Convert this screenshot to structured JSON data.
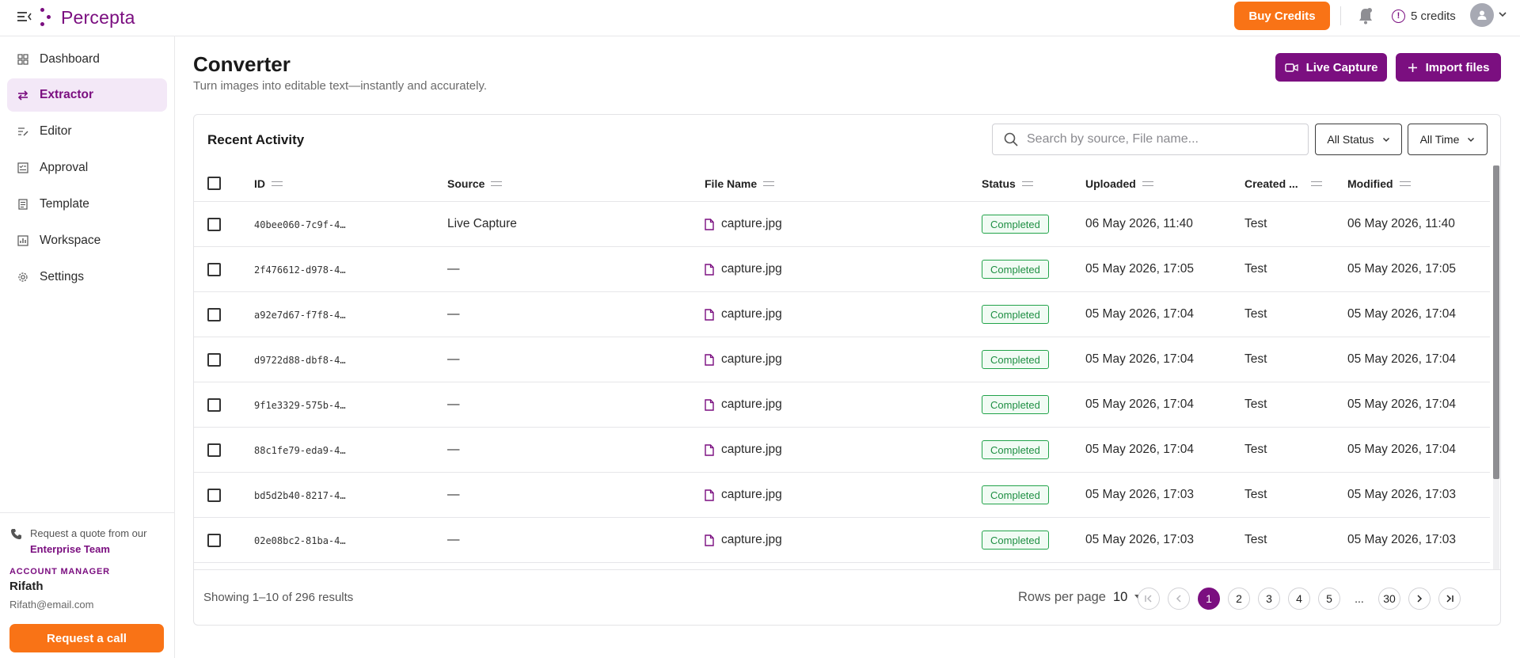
{
  "app": {
    "name": "Percepta"
  },
  "topbar": {
    "buy_label": "Buy Credits",
    "credits_label": "5 credits"
  },
  "sidebar": {
    "items": [
      {
        "label": "Dashboard",
        "icon": "grid-icon"
      },
      {
        "label": "Extractor",
        "icon": "swap-icon"
      },
      {
        "label": "Editor",
        "icon": "edit-lines-icon"
      },
      {
        "label": "Approval",
        "icon": "approval-icon"
      },
      {
        "label": "Template",
        "icon": "document-icon"
      },
      {
        "label": "Workspace",
        "icon": "chart-icon"
      },
      {
        "label": "Settings",
        "icon": "gear-icon"
      }
    ],
    "quote_text": "Request a quote from our",
    "quote_link": "Enterprise Team",
    "manager_label": "ACCOUNT MANAGER",
    "manager_name": "Rifath",
    "manager_email": "Rifath@email.com",
    "call_label": "Request a call"
  },
  "header": {
    "title": "Converter",
    "subtitle": "Turn images into editable text—instantly and accurately.",
    "live_capture_label": "Live Capture",
    "import_label": "Import files"
  },
  "activity": {
    "title": "Recent Activity",
    "search_placeholder": "Search by source, File name...",
    "status_filter": "All Status",
    "time_filter": "All Time",
    "columns": {
      "id": "ID",
      "source": "Source",
      "file_name": "File Name",
      "status": "Status",
      "uploaded": "Uploaded",
      "created_by": "Created ...",
      "modified": "Modified"
    },
    "rows": [
      {
        "id": "40bee060-7c9f-4…",
        "source": "Live Capture",
        "file": "capture.jpg",
        "status": "Completed",
        "uploaded": "06 May 2026, 11:40",
        "created_by": "Test",
        "modified": "06 May 2026, 11:40"
      },
      {
        "id": "2f476612-d978-4…",
        "source": "—",
        "file": "capture.jpg",
        "status": "Completed",
        "uploaded": "05 May 2026, 17:05",
        "created_by": "Test",
        "modified": "05 May 2026, 17:05"
      },
      {
        "id": "a92e7d67-f7f8-4…",
        "source": "—",
        "file": "capture.jpg",
        "status": "Completed",
        "uploaded": "05 May 2026, 17:04",
        "created_by": "Test",
        "modified": "05 May 2026, 17:04"
      },
      {
        "id": "d9722d88-dbf8-4…",
        "source": "—",
        "file": "capture.jpg",
        "status": "Completed",
        "uploaded": "05 May 2026, 17:04",
        "created_by": "Test",
        "modified": "05 May 2026, 17:04"
      },
      {
        "id": "9f1e3329-575b-4…",
        "source": "—",
        "file": "capture.jpg",
        "status": "Completed",
        "uploaded": "05 May 2026, 17:04",
        "created_by": "Test",
        "modified": "05 May 2026, 17:04"
      },
      {
        "id": "88c1fe79-eda9-4…",
        "source": "—",
        "file": "capture.jpg",
        "status": "Completed",
        "uploaded": "05 May 2026, 17:04",
        "created_by": "Test",
        "modified": "05 May 2026, 17:04"
      },
      {
        "id": "bd5d2b40-8217-4…",
        "source": "—",
        "file": "capture.jpg",
        "status": "Completed",
        "uploaded": "05 May 2026, 17:03",
        "created_by": "Test",
        "modified": "05 May 2026, 17:03"
      },
      {
        "id": "02e08bc2-81ba-4…",
        "source": "—",
        "file": "capture.jpg",
        "status": "Completed",
        "uploaded": "05 May 2026, 17:03",
        "created_by": "Test",
        "modified": "05 May 2026, 17:03"
      }
    ]
  },
  "pagination": {
    "showing": "Showing 1–10 of 296 results",
    "rows_per_page_label": "Rows per page",
    "rows_per_page_value": "10",
    "pages": [
      "1",
      "2",
      "3",
      "4",
      "5",
      "...",
      "30"
    ],
    "current_page": "1"
  },
  "colors": {
    "brand": "#7b0f80",
    "accent": "#f97316",
    "success": "#22a34a"
  }
}
